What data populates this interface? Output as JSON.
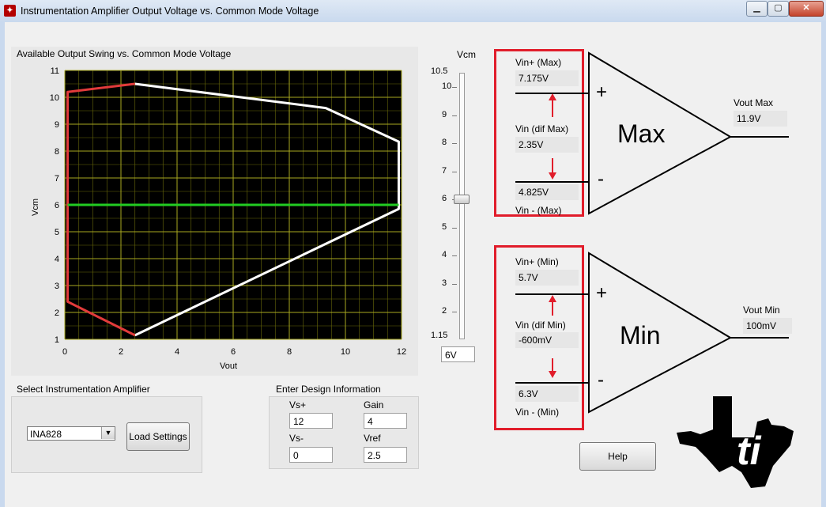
{
  "window": {
    "title": "Instrumentation Amplifier Output Voltage vs. Common Mode Voltage",
    "controls": [
      "minimize",
      "maximize",
      "close"
    ]
  },
  "graph": {
    "title": "Available Output Swing vs. Common Mode Voltage",
    "xlabel": "Vout",
    "ylabel": "Vcm",
    "xticks": [
      "0",
      "2",
      "4",
      "6",
      "8",
      "10",
      "12"
    ],
    "yticks": [
      "1",
      "2",
      "3",
      "4",
      "5",
      "6",
      "7",
      "8",
      "9",
      "10",
      "11"
    ]
  },
  "chart_data": {
    "type": "line",
    "xlabel": "Vout",
    "ylabel": "Vcm",
    "xlim": [
      0,
      12
    ],
    "ylim": [
      1,
      11
    ],
    "grid": true,
    "series": [
      {
        "color": "#ffffff",
        "x": [
          2.5,
          9.3,
          11.9,
          11.9,
          2.5
        ],
        "y": [
          10.5,
          9.6,
          8.35,
          5.85,
          1.15
        ]
      },
      {
        "color": "#e23b3b",
        "x": [
          2.5,
          0.1,
          0.1,
          0.1,
          2.5
        ],
        "y": [
          10.5,
          10.2,
          6,
          2.4,
          1.15
        ]
      },
      {
        "color": "#22cc22",
        "x": [
          0.1,
          11.9
        ],
        "y": [
          6,
          6
        ]
      }
    ]
  },
  "slider": {
    "label": "Vcm",
    "max": "10.5",
    "min": "1.15",
    "ticks": [
      "10",
      "9",
      "8",
      "7",
      "6",
      "5",
      "4",
      "3",
      "2"
    ],
    "value": "6V",
    "level": 6
  },
  "amp_select": {
    "title": "Select Instrumentation Amplifier",
    "value": "INA828",
    "load_label": "Load Settings"
  },
  "design": {
    "title": "Enter Design Information",
    "vs_plus_label": "Vs+",
    "vs_plus": "12",
    "gain_label": "Gain",
    "gain": "4",
    "vs_minus_label": "Vs-",
    "vs_minus": "0",
    "vref_label": "Vref",
    "vref": "2.5"
  },
  "max_amp": {
    "vin_plus_label": "Vin+ (Max)",
    "vin_plus": "7.175V",
    "vin_dif_label": "Vin (dif Max)",
    "vin_dif": "2.35V",
    "vin_minus": "4.825V",
    "vin_minus_label": "Vin - (Max)",
    "name": "Max",
    "out_label": "Vout Max",
    "out": "11.9V"
  },
  "min_amp": {
    "vin_plus_label": "Vin+ (Min)",
    "vin_plus": "5.7V",
    "vin_dif_label": "Vin (dif Min)",
    "vin_dif": "-600mV",
    "vin_minus": "6.3V",
    "vin_minus_label": "Vin - (Min)",
    "name": "Min",
    "out_label": "Vout Min",
    "out": "100mV"
  },
  "signs": {
    "plus": "+",
    "minus": "-"
  },
  "help_label": "Help",
  "logo": {
    "text": "ti",
    "colors": {
      "shape": "#000000"
    }
  }
}
